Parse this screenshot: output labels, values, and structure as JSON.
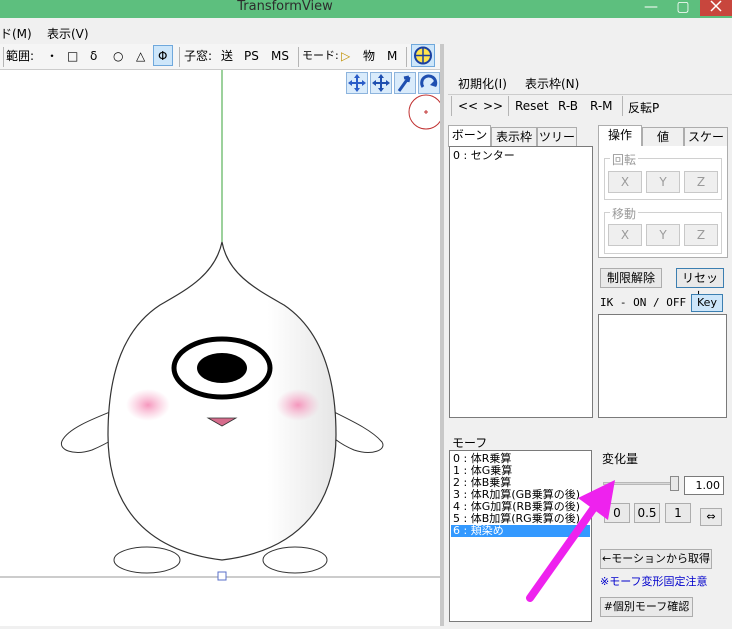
{
  "window": {
    "title": "TransformView",
    "minimize": "—",
    "maximize": "▢"
  },
  "menu": {
    "items": [
      "ド(M)",
      "表示(V)"
    ]
  },
  "toolbar": {
    "range_label": "範囲:",
    "range_items": [
      "・",
      "□",
      "δ",
      "○",
      "△",
      "Φ"
    ],
    "child_window_label": "子窓:",
    "child_items": [
      "送",
      "PS",
      "MS"
    ],
    "mode_label": "モード:",
    "mode_items": [
      "▷",
      "物",
      "M"
    ]
  },
  "right_menu": {
    "items": [
      "初期化(I)",
      "表示枠(N)"
    ]
  },
  "right_toolbar": {
    "items": [
      "<<",
      ">>",
      "Reset",
      "R-B",
      "R-M",
      "反転P"
    ]
  },
  "bone_panel": {
    "tabs": [
      "ボーン",
      "表示枠",
      "ツリー"
    ],
    "items": [
      "0 : センター"
    ]
  },
  "op_panel": {
    "tabs": [
      "操作",
      "値",
      "スケール"
    ],
    "rotate_label": "回転",
    "move_label": "移動",
    "axis_buttons": [
      "X",
      "Y",
      "Z"
    ],
    "release_limit": "制限解除",
    "reset": "リセット",
    "ik_label": "IK - ON / OFF",
    "key": "Key"
  },
  "morph_panel": {
    "label": "モーフ",
    "items": [
      "0 : 体R乗算",
      "1 : 体G乗算",
      "2 : 体B乗算",
      "3 : 体R加算(GB乗算の後)",
      "4 : 体G加算(RB乗算の後)",
      "5 : 体B加算(RG乗算の後)",
      "6 : 頬染め"
    ],
    "selected_index": 6
  },
  "change_panel": {
    "label": "変化量",
    "value": "1.00",
    "slider_fraction": 0.93,
    "preset_buttons": [
      "0",
      "0.5",
      "1"
    ],
    "expand_icon": "⇔",
    "from_motion": "←モーションから取得",
    "note": "※モーフ変形固定注意",
    "confirm": "#個別モーフ確認"
  },
  "colors": {
    "title_bar": "#5dbf7e",
    "selection": "#3399ff",
    "note": "#0000cc",
    "arrow": "#ee22ee",
    "blush": "#f7a9c8"
  }
}
